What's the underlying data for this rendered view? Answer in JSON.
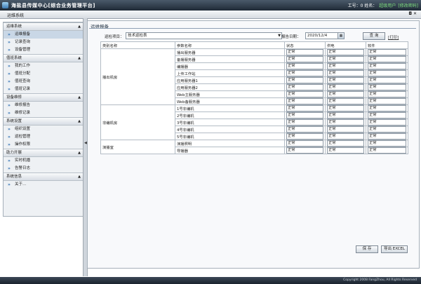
{
  "header": {
    "title": "海盐县传媒中心[综合业务管理平台]",
    "user_label": "工号：0 姓名：",
    "user_name": "超级用户",
    "change_password": "[修改密码]"
  },
  "subbar": {
    "title": "运维系统"
  },
  "sidebar": {
    "groups": [
      {
        "title": "运维系统",
        "items": [
          "运维报备",
          "记录查询",
          "设备管理"
        ]
      },
      {
        "title": "值班系统",
        "items": [
          "我的工作",
          "值班分配",
          "值班查询",
          "值班记录"
        ]
      },
      {
        "title": "设备维修",
        "items": [
          "维修报告",
          "维修记录"
        ]
      },
      {
        "title": "系统设置",
        "items": [
          "组织设置",
          "巡检管理",
          "操作权限"
        ]
      },
      {
        "title": "助力开展",
        "items": [
          "实时机播",
          "告警日志"
        ]
      },
      {
        "title": "系统信息",
        "items": [
          "关于..."
        ]
      }
    ]
  },
  "main": {
    "title": "运维报备",
    "project_label": "巡检项目：",
    "project_value": "技术巡检表",
    "date_label": "报告日期：",
    "date_value": "2020/12/4",
    "query_button": "查 询",
    "print_link": "[打印]",
    "save_button": "保 存",
    "export_button": "导出 EXCEL"
  },
  "table": {
    "headers": [
      "类别名称",
      "参数名称",
      "状态",
      "供电",
      "软件"
    ],
    "groups": [
      {
        "category": "播出机房",
        "rows": [
          {
            "param": "播出服务器",
            "status": "正常",
            "power": "正常",
            "software": "正常"
          },
          {
            "param": "备播服务器",
            "status": "正常",
            "power": "正常",
            "software": "正常"
          },
          {
            "param": "编播器",
            "status": "正常",
            "power": "正常",
            "software": "正常"
          },
          {
            "param": "上传工作站",
            "status": "正常",
            "power": "正常",
            "software": "正常"
          },
          {
            "param": "应用服务器1",
            "status": "正常",
            "power": "正常",
            "software": "正常"
          },
          {
            "param": "应用服务器2",
            "status": "正常",
            "power": "正常",
            "software": "正常"
          },
          {
            "param": "Web主服务器",
            "status": "正常",
            "power": "正常",
            "software": "正常"
          },
          {
            "param": "Web备服务器",
            "status": "正常",
            "power": "正常",
            "software": "正常"
          }
        ]
      },
      {
        "category": "非编机房",
        "rows": [
          {
            "param": "1号非编机",
            "status": "正常",
            "power": "正常",
            "software": "正常"
          },
          {
            "param": "2号非编机",
            "status": "正常",
            "power": "正常",
            "software": "正常"
          },
          {
            "param": "3号非编机",
            "status": "正常",
            "power": "正常",
            "software": "正常"
          },
          {
            "param": "4号非编机",
            "status": "正常",
            "power": "正常",
            "software": "正常"
          },
          {
            "param": "5号非编机",
            "status": "正常",
            "power": "正常",
            "software": "正常"
          }
        ]
      },
      {
        "category": "演播室",
        "rows": [
          {
            "param": "演播照明",
            "status": "正常",
            "power": "正常",
            "software": "正常"
          },
          {
            "param": "导播器",
            "status": "正常",
            "power": "正常",
            "software": "正常"
          }
        ]
      }
    ]
  },
  "footer": {
    "copyright": "Copyright 2008 FangZhou, All Rights Reserved"
  },
  "colors": {
    "header_bg": "#2a3643",
    "user_link": "#7fe07f",
    "bullet": "#2f6fb3",
    "active_item": "#c9d7e6"
  }
}
